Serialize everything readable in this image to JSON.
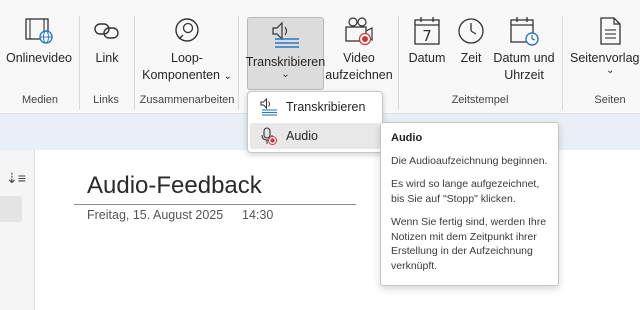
{
  "ribbon": {
    "buttons": {
      "onlinevideo": "Onlinevideo",
      "links": "Link",
      "loop_line1": "Loop-",
      "loop_line2": "Komponenten",
      "transcribe": "Transkribieren",
      "video_line1": "Video",
      "video_line2": "aufzeichnen",
      "date": "Datum",
      "time": "Zeit",
      "datetime_line1": "Datum und",
      "datetime_line2": "Uhrzeit",
      "pagetemplate": "Seitenvorlage"
    },
    "groups": {
      "media": "Medien",
      "links": "Links",
      "collab": "Zusammenarbeiten",
      "timestamp": "Zeitstempel",
      "pages": "Seiten"
    },
    "calendar_day": "7"
  },
  "dropdown": {
    "items": [
      "Transkribieren",
      "Audio"
    ]
  },
  "tooltip": {
    "title": "Audio",
    "p1": "Die Audioaufzeichnung beginnen.",
    "p2": "Es wird so lange aufgezeichnet, bis Sie auf \"Stopp\" klicken.",
    "p3": "Wenn Sie fertig sind, werden Ihre Notizen mit dem Zeitpunkt ihrer Erstellung in der Aufzeichnung verknüpft."
  },
  "page": {
    "title": "Audio-Feedback",
    "date": "Freitag, 15. August 2025",
    "time": "14:30"
  },
  "colors": {
    "accent_blue": "#2b78c5",
    "record_red": "#d13438"
  }
}
